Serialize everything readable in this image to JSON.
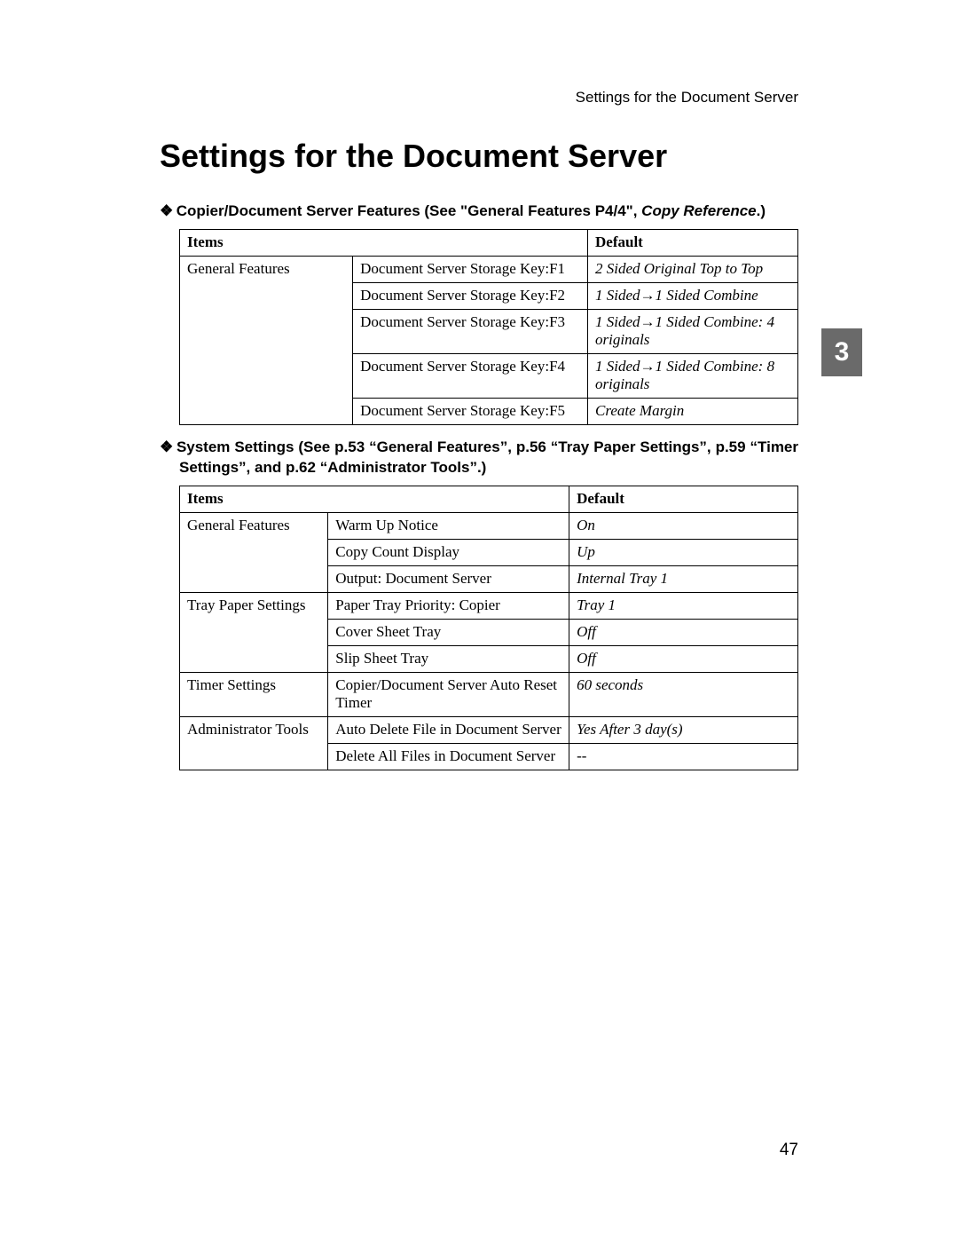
{
  "header": {
    "running": "Settings for the Document Server"
  },
  "title": "Settings for the Document Server",
  "page_number": "47",
  "chapter_tab": "3",
  "bullets": {
    "diamond": "❖"
  },
  "section1": {
    "heading_plain": "Copier/Document Server Features (See \"General Features P4/4\", ",
    "heading_ital": "Copy Reference",
    "heading_tail": ".)",
    "columns": {
      "items": "Items",
      "default": "Default"
    },
    "category": "General Features",
    "rows": [
      {
        "sub": "Document Server Storage Key:F1",
        "def": "2 Sided Original Top to Top"
      },
      {
        "sub": "Document Server Storage Key:F2",
        "def": "1 Sided→1 Sided Combine"
      },
      {
        "sub": "Document Server Storage Key:F3",
        "def": "1 Sided→1 Sided Combine: 4 originals"
      },
      {
        "sub": "Document Server Storage Key:F4",
        "def": "1 Sided→1 Sided Combine: 8 originals"
      },
      {
        "sub": "Document Server Storage Key:F5",
        "def": "Create Margin"
      }
    ]
  },
  "section2": {
    "heading": "System Settings (See p.53 “General Features”, p.56 “Tray Paper Settings”, p.59 “Timer Settings”, and p.62 “Administrator Tools”.)",
    "columns": {
      "items": "Items",
      "default": "Default"
    },
    "groups": [
      {
        "category": "General Features",
        "rows": [
          {
            "sub": "Warm Up Notice",
            "def": "On"
          },
          {
            "sub": "Copy Count Display",
            "def": "Up"
          },
          {
            "sub": "Output: Document Server",
            "def": "Internal Tray 1"
          }
        ]
      },
      {
        "category": "Tray Paper Settings",
        "rows": [
          {
            "sub": "Paper Tray Priority: Copier",
            "def": "Tray 1"
          },
          {
            "sub": "Cover Sheet Tray",
            "def": "Off"
          },
          {
            "sub": "Slip Sheet Tray",
            "def": "Off"
          }
        ]
      },
      {
        "category": "Timer Settings",
        "rows": [
          {
            "sub": "Copier/Document Server Auto Reset Timer",
            "def": "60 seconds"
          }
        ]
      },
      {
        "category": "Administrator Tools",
        "rows": [
          {
            "sub": "Auto Delete File in Document Server",
            "def": "Yes After 3 day(s)"
          },
          {
            "sub": "Delete All Files in Document Server",
            "def": "--",
            "def_plain": true
          }
        ]
      }
    ]
  }
}
